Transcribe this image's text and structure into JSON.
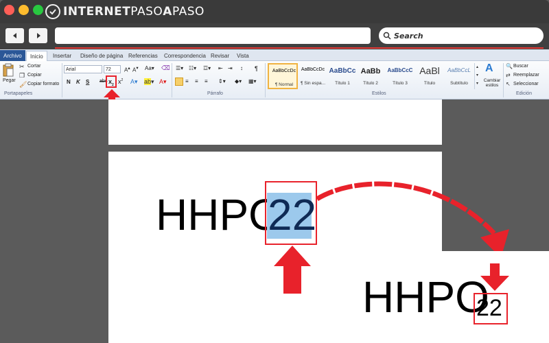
{
  "browser": {
    "logo": {
      "part1": "INTERNET",
      "part2": "PASO",
      "part3": "A",
      "part4": "PASO"
    },
    "search_label": "Search"
  },
  "ribbon": {
    "tabs": [
      "Archivo",
      "Inicio",
      "Insertar",
      "Diseño de página",
      "Referencias",
      "Correspondencia",
      "Revisar",
      "Vista"
    ],
    "clipboard": {
      "paste": "Pegar",
      "cut": "Cortar",
      "copy": "Copiar",
      "format_painter": "Copiar formato",
      "group": "Portapapeles"
    },
    "font": {
      "family": "Arial",
      "size": "72",
      "bold": "N",
      "italic": "K",
      "underline": "S",
      "strike": "abc"
    },
    "paragraph": {
      "group": "Párrafo"
    },
    "styles": {
      "group": "Estilos",
      "items": [
        {
          "sample": "AaBbCcDc",
          "name": "¶ Normal"
        },
        {
          "sample": "AaBbCcDc",
          "name": "¶ Sin espa..."
        },
        {
          "sample": "AaBbCc",
          "name": "Título 1"
        },
        {
          "sample": "AaBb",
          "name": "Título 2"
        },
        {
          "sample": "AaBbCcC",
          "name": "Título 3"
        },
        {
          "sample": "AaBl",
          "name": "Título"
        },
        {
          "sample": "AaBbCcL",
          "name": "Subtítulo"
        }
      ],
      "change": "Cambiar estilos"
    },
    "editing": {
      "find": "Buscar",
      "replace": "Reemplazar",
      "select": "Seleccionar",
      "group": "Edición"
    }
  },
  "document": {
    "text_before": "HHPO",
    "text_selected": "22",
    "result_base": "HHPO",
    "result_subscript": "22"
  },
  "colors": {
    "accent_red": "#e8222b",
    "selection": "#9cc9ec",
    "archivo_tab": "#2b5797"
  }
}
